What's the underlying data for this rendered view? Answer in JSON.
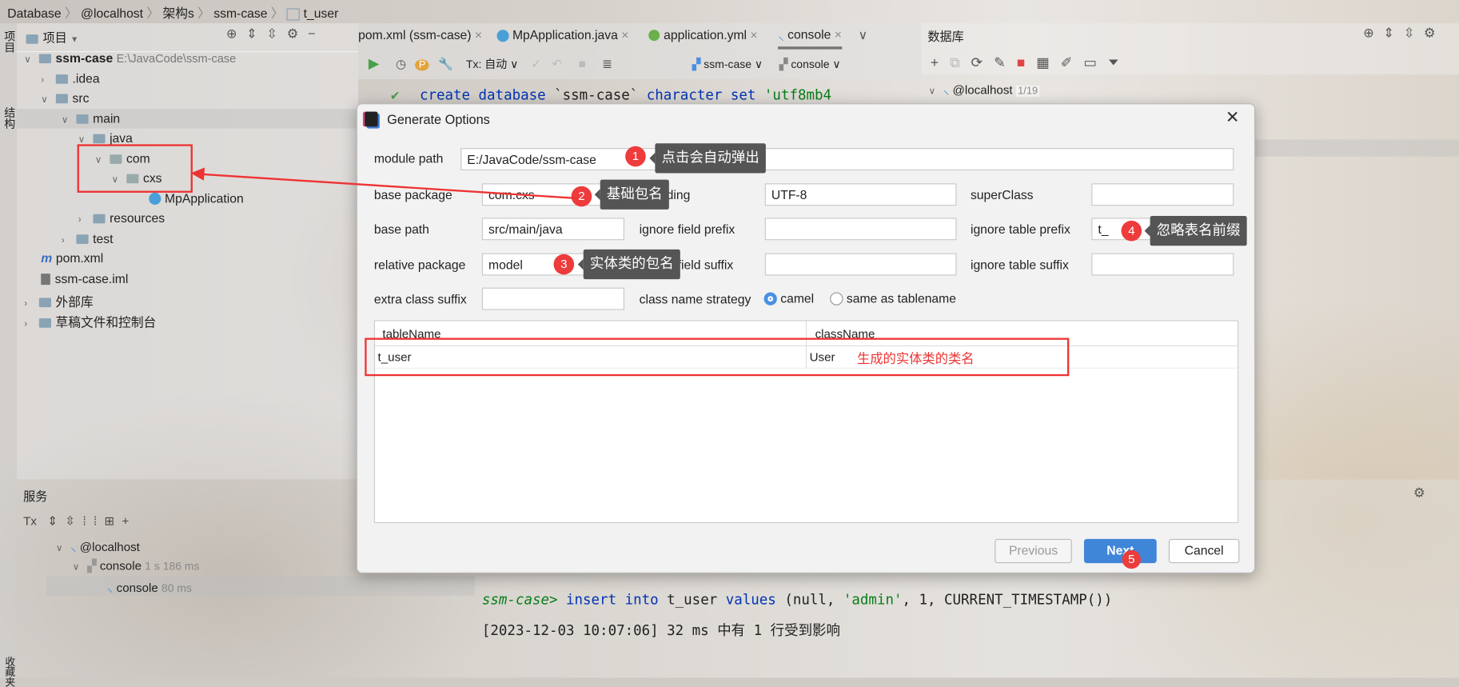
{
  "breadcrumb": [
    "Database",
    "@localhost",
    "架构s",
    "ssm-case",
    "t_user"
  ],
  "left_strip": {
    "project": "项目",
    "structure": "结构",
    "favorites": "收藏夹"
  },
  "project_panel": {
    "title": "项目",
    "tree": [
      {
        "label": "ssm-case",
        "hint": "E:\\JavaCode\\ssm-case",
        "level": 0,
        "type": "module"
      },
      {
        "label": ".idea",
        "level": 1,
        "type": "folder"
      },
      {
        "label": "src",
        "level": 1,
        "type": "folder"
      },
      {
        "label": "main",
        "level": 2,
        "type": "folder"
      },
      {
        "label": "java",
        "level": 3,
        "type": "folder"
      },
      {
        "label": "com",
        "level": 4,
        "type": "package"
      },
      {
        "label": "cxs",
        "level": 5,
        "type": "package"
      },
      {
        "label": "MpApplication",
        "level": 6,
        "type": "class"
      },
      {
        "label": "resources",
        "level": 3,
        "type": "folder"
      },
      {
        "label": "test",
        "level": 2,
        "type": "folder"
      },
      {
        "label": "pom.xml",
        "level": 1,
        "type": "maven"
      },
      {
        "label": "ssm-case.iml",
        "level": 1,
        "type": "file"
      },
      {
        "label": "外部库",
        "level": 0,
        "type": "library"
      },
      {
        "label": "草稿文件和控制台",
        "level": 0,
        "type": "scratch"
      }
    ]
  },
  "editor_tabs": [
    {
      "label": "pom.xml (ssm-case)"
    },
    {
      "label": "MpApplication.java"
    },
    {
      "label": "application.yml"
    },
    {
      "label": "console",
      "active": true
    }
  ],
  "editor_toolbar": {
    "tx": "Tx: 自动",
    "datasource": "ssm-case",
    "session": "console"
  },
  "editor_code": {
    "line1_keyword": "create database",
    "line1_name": "`ssm-case`",
    "line1_kw2": "character set",
    "line1_str": "'utf8mb4"
  },
  "database_panel": {
    "title": "数据库",
    "host": "@localhost",
    "count": "1/19"
  },
  "services_panel": {
    "title": "服务",
    "tx": "Tx",
    "tree": [
      {
        "label": "@localhost",
        "time": ""
      },
      {
        "label": "console",
        "time": "1 s 186 ms"
      },
      {
        "label": "console",
        "time": "80 ms"
      }
    ]
  },
  "console_output": {
    "prompt": "ssm-case>",
    "sql_kw1": "insert into",
    "sql_table": "t_user",
    "sql_kw2": "values",
    "sql_args_pre": "(null, ",
    "sql_str": "'admin'",
    "sql_args_post": ", 1, CURRENT_TIMESTAMP())",
    "result": "[2023-12-03 10:07:06] 32 ms 中有 1 行受到影响"
  },
  "dialog": {
    "title": "Generate Options",
    "module_path": {
      "label": "module path",
      "value": "E:/JavaCode/ssm-case"
    },
    "base_package": {
      "label": "base package",
      "value": "com.cxs"
    },
    "encoding": {
      "label": "encoding",
      "value": "UTF-8"
    },
    "super_class": {
      "label": "superClass",
      "value": ""
    },
    "base_path": {
      "label": "base path",
      "value": "src/main/java"
    },
    "ignore_field_prefix": {
      "label": "ignore field prefix",
      "value": ""
    },
    "ignore_table_prefix": {
      "label": "ignore table prefix",
      "value": "t_"
    },
    "relative_package": {
      "label": "relative package",
      "value": "model"
    },
    "ignore_field_suffix": {
      "label": "ignore field suffix",
      "value": ""
    },
    "ignore_table_suffix": {
      "label": "ignore table suffix",
      "value": ""
    },
    "extra_class_suffix": {
      "label": "extra class suffix",
      "value": ""
    },
    "class_name_strategy": {
      "label": "class name strategy",
      "options": [
        "camel",
        "same as tablename"
      ],
      "selected": "camel"
    },
    "table": {
      "columns": [
        "tableName",
        "className"
      ],
      "rows": [
        [
          "t_user",
          "User"
        ]
      ]
    },
    "buttons": {
      "previous": "Previous",
      "next": "Next",
      "cancel": "Cancel"
    }
  },
  "annotations": [
    {
      "n": "1",
      "text": "点击会自动弹出"
    },
    {
      "n": "2",
      "text": "基础包名"
    },
    {
      "n": "3",
      "text": "实体类的包名"
    },
    {
      "n": "4",
      "text": "忽略表名前缀"
    },
    {
      "n": "5",
      "text": ""
    },
    {
      "n": "",
      "text": "生成的实体类的类名"
    }
  ],
  "colors": {
    "accent": "#4a90e2",
    "annotation_red": "#ee3b3b",
    "callout_bg": "#555555",
    "sql_keyword": "#0033b3",
    "sql_string": "#067d17"
  }
}
